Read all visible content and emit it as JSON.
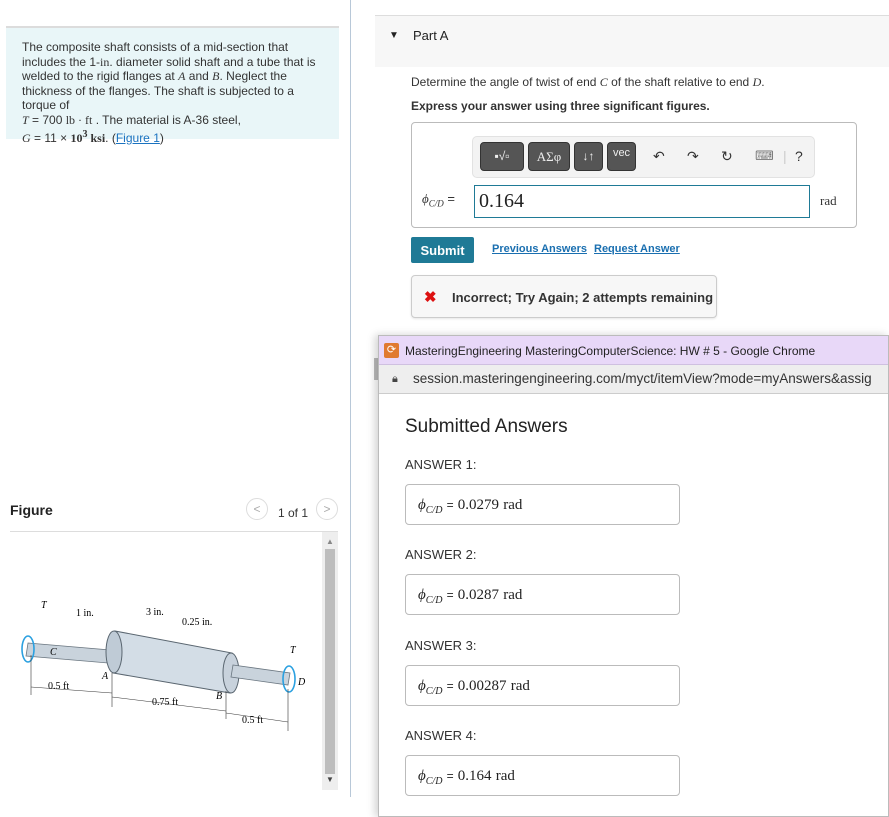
{
  "problem": {
    "text_parts": [
      "The composite shaft consists of a mid-section that includes the 1-",
      "in",
      ". diameter solid shaft and a tube that is welded to the rigid flanges at ",
      "A",
      " and ",
      "B",
      ". Neglect the thickness of the flanges. The shaft is subjected to a torque of ",
      "T",
      " = 700 ",
      "lb · ft",
      " . The material is A-36 steel, ",
      "G",
      " = 11 × ",
      "10",
      "3",
      " ksi",
      ". ("
    ],
    "figure_link": "Figure 1",
    "close_paren": ")"
  },
  "figure": {
    "title": "Figure",
    "pager": "1 of 1",
    "prev_icon": "chevron-left-icon",
    "next_icon": "chevron-right-icon",
    "labels": {
      "T_left": "T",
      "T_right": "T",
      "d_solid": "1 in.",
      "d_tube": "3 in.",
      "t_tube": "0.25 in.",
      "C": "C",
      "A": "A",
      "B": "B",
      "D": "D",
      "L1": "0.5 ft",
      "L2": "0.75 ft",
      "L3": "0.5 ft"
    }
  },
  "part": {
    "title": "Part A",
    "question_pre": "Determine the angle of twist of end ",
    "question_C": "C",
    "question_mid": " of the shaft relative to end ",
    "question_D": "D",
    "question_end": ".",
    "instruction": "Express your answer using three significant figures."
  },
  "toolbar": {
    "templates": "▪√▫",
    "greek": "ΑΣφ",
    "arrows": "↓↑",
    "vec": "vec",
    "undo": "↶",
    "redo": "↷",
    "reset": "↻",
    "keyboard": "⌨",
    "help": "?"
  },
  "answer": {
    "symbol": "ϕ",
    "subscript": "C/D",
    "equals": "=",
    "value": "0.164",
    "unit": "rad"
  },
  "actions": {
    "submit": "Submit",
    "previous_answers": "Previous Answers",
    "request_answer": "Request Answer"
  },
  "feedback": {
    "icon": "✖",
    "text": "Incorrect; Try Again; 2 attempts remaining",
    "color": "#dd1111"
  },
  "popup": {
    "window_title": "MasteringEngineering MasteringComputerScience: HW # 5 - Google Chrome",
    "url": "session.masteringengineering.com/myct/itemView?mode=myAnswers&assig",
    "heading": "Submitted Answers",
    "answers": [
      {
        "label": "ANSWER 1:",
        "value": "0.0279",
        "unit": "rad"
      },
      {
        "label": "ANSWER 2:",
        "value": "0.0287",
        "unit": "rad"
      },
      {
        "label": "ANSWER 3:",
        "value": "0.00287",
        "unit": "rad"
      },
      {
        "label": "ANSWER 4:",
        "value": "0.164",
        "unit": "rad"
      }
    ]
  },
  "colors": {
    "accent": "#1f7a96",
    "problem_bg": "#e9f6f8",
    "popup_titlebar": "#e8d8f8",
    "link": "#1a6fb0"
  }
}
